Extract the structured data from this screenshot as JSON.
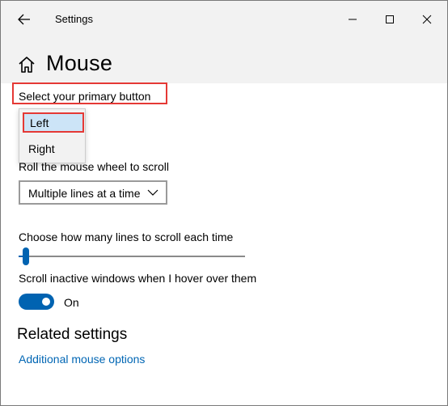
{
  "window": {
    "title": "Settings"
  },
  "page": {
    "title": "Mouse"
  },
  "primary_button": {
    "label": "Select your primary button",
    "options": [
      "Left",
      "Right"
    ],
    "selected": "Left"
  },
  "scroll": {
    "label": "Roll the mouse wheel to scroll",
    "value": "Multiple lines at a time"
  },
  "lines": {
    "label": "Choose how many lines to scroll each time",
    "slider_fraction": 0.03
  },
  "inactive": {
    "label": "Scroll inactive windows when I hover over them",
    "state": "On"
  },
  "related": {
    "title": "Related settings",
    "link": "Additional mouse options"
  },
  "colors": {
    "accent": "#0063b1",
    "link": "#0066b4",
    "highlight": "#e53935",
    "header_bg": "#f2f2f2"
  },
  "icons": {
    "back": "back-arrow-icon",
    "home": "home-icon",
    "minimize": "minimize-icon",
    "maximize": "maximize-icon",
    "close": "close-icon",
    "chevron": "chevron-down-icon"
  }
}
